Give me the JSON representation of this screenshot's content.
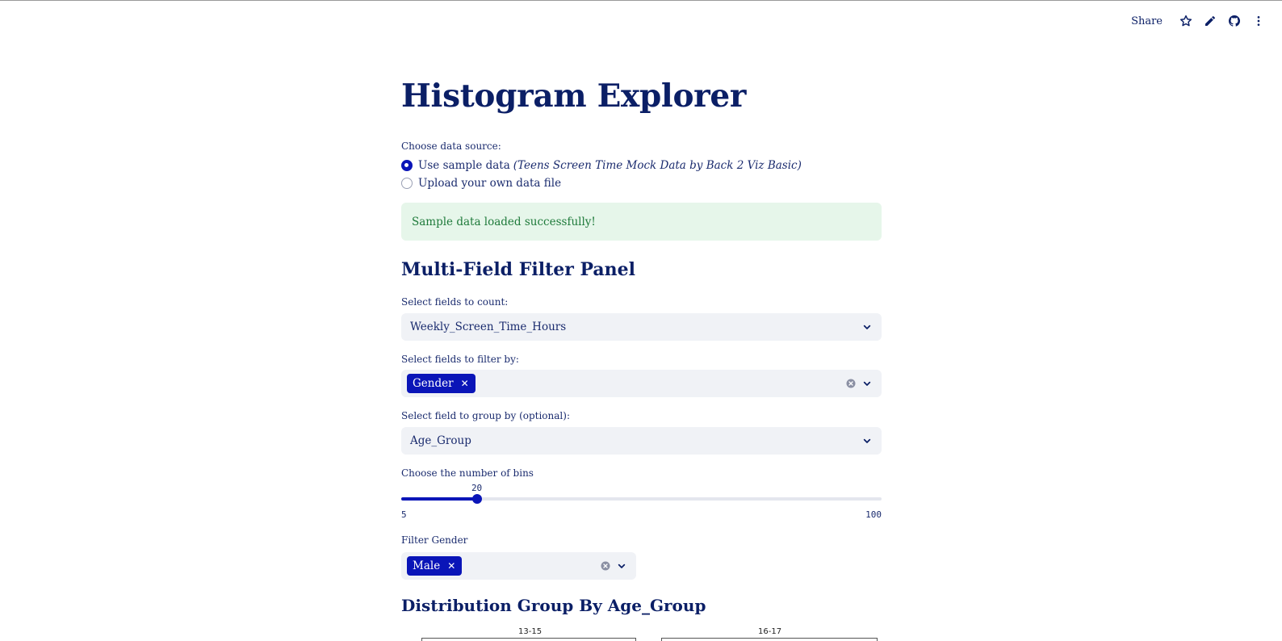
{
  "toolbar": {
    "share_label": "Share",
    "icons": [
      "star-icon",
      "pencil-icon",
      "github-icon",
      "more-vertical-icon"
    ]
  },
  "page": {
    "title": "Histogram Explorer"
  },
  "data_source": {
    "label": "Choose data source:",
    "options": [
      {
        "label": "Use sample data",
        "note": "(Teens Screen Time Mock Data by Back 2 Viz Basic)",
        "selected": true
      },
      {
        "label": "Upload your own data file",
        "selected": false
      }
    ]
  },
  "alert": {
    "message": "Sample data loaded successfully!",
    "color": "#e6f6ea"
  },
  "filter_panel": {
    "heading": "Multi-Field Filter Panel",
    "count_fields": {
      "label": "Select fields to count:",
      "value": "Weekly_Screen_Time_Hours"
    },
    "filter_fields": {
      "label": "Select fields to filter by:",
      "tags": [
        "Gender"
      ]
    },
    "group_field": {
      "label": "Select field to group by (optional):",
      "value": "Age_Group"
    },
    "bins": {
      "label": "Choose the number of bins",
      "value": 20,
      "min": 5,
      "max": 100
    },
    "gender_filter": {
      "label": "Filter Gender",
      "tags": [
        "Male"
      ]
    }
  },
  "distribution": {
    "heading": "Distribution Group By Age_Group",
    "facets": [
      "13-15",
      "16-17"
    ]
  },
  "colors": {
    "primary": "#0a15b8",
    "text": "#0b1f66",
    "input_bg": "#f0f2f6"
  }
}
